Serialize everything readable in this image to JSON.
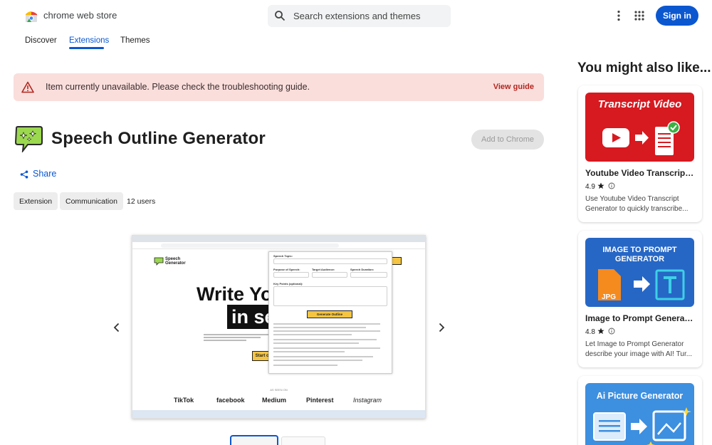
{
  "header": {
    "store_name": "chrome web store",
    "search_placeholder": "Search extensions and themes",
    "signin_label": "Sign in"
  },
  "nav": {
    "tabs": [
      {
        "label": "Discover",
        "active": false
      },
      {
        "label": "Extensions",
        "active": true
      },
      {
        "label": "Themes",
        "active": false
      }
    ]
  },
  "banner": {
    "message": "Item currently unavailable. Please check the troubleshooting guide.",
    "link_label": "View guide"
  },
  "extension": {
    "title": "Speech Outline Generator",
    "add_label": "Add to Chrome",
    "share_label": "Share",
    "chips": [
      "Extension",
      "Communication"
    ],
    "users": "12 users"
  },
  "screenshot": {
    "logo_line1": "Speech",
    "logo_line2": "Generator",
    "headline1": "Write Yo",
    "headline2": "in se",
    "start_label": "Start c",
    "generate_label": "Generate Outline",
    "panel_labels": [
      "Speech Topic:",
      "Purpose of Speech:",
      "Target Audience:",
      "Speech Duration:",
      "Key Points (optional):"
    ],
    "as_seen_on": "AS SEEN ON",
    "brands": [
      "TikTok",
      "facebook",
      "Medium",
      "Pinterest",
      "Instagram"
    ]
  },
  "sidebar": {
    "heading": "You might also like...",
    "cards": [
      {
        "name": "Youtube Video Transcript...",
        "rating": "4.9",
        "description": "Use Youtube Video Transcript Generator to quickly transcribe...",
        "thumb_title": "Transcript Video",
        "thumb_bg": "#d71920"
      },
      {
        "name": "Image to Prompt Generator",
        "rating": "4.8",
        "description": "Let Image to Prompt Generator describe your image with AI! Tur...",
        "thumb_title_line1": "IMAGE TO PROMPT",
        "thumb_title_line2": "GENERATOR",
        "thumb_badge": "JPG",
        "thumb_bg": "#2667c6"
      },
      {
        "thumb_title": "Ai Picture Generator",
        "thumb_bg": "#3d8fe0"
      }
    ]
  },
  "colors": {
    "accent": "#0b57d0",
    "banner_bg": "#f9dedc",
    "warning": "#b3261e"
  }
}
